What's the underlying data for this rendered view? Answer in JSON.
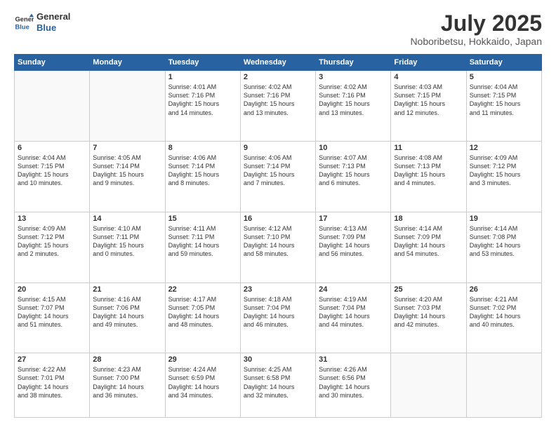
{
  "header": {
    "logo_line1": "General",
    "logo_line2": "Blue",
    "month_title": "July 2025",
    "location": "Noboribetsu, Hokkaido, Japan"
  },
  "days_of_week": [
    "Sunday",
    "Monday",
    "Tuesday",
    "Wednesday",
    "Thursday",
    "Friday",
    "Saturday"
  ],
  "weeks": [
    [
      {
        "day": "",
        "text": ""
      },
      {
        "day": "",
        "text": ""
      },
      {
        "day": "1",
        "text": "Sunrise: 4:01 AM\nSunset: 7:16 PM\nDaylight: 15 hours\nand 14 minutes."
      },
      {
        "day": "2",
        "text": "Sunrise: 4:02 AM\nSunset: 7:16 PM\nDaylight: 15 hours\nand 13 minutes."
      },
      {
        "day": "3",
        "text": "Sunrise: 4:02 AM\nSunset: 7:16 PM\nDaylight: 15 hours\nand 13 minutes."
      },
      {
        "day": "4",
        "text": "Sunrise: 4:03 AM\nSunset: 7:15 PM\nDaylight: 15 hours\nand 12 minutes."
      },
      {
        "day": "5",
        "text": "Sunrise: 4:04 AM\nSunset: 7:15 PM\nDaylight: 15 hours\nand 11 minutes."
      }
    ],
    [
      {
        "day": "6",
        "text": "Sunrise: 4:04 AM\nSunset: 7:15 PM\nDaylight: 15 hours\nand 10 minutes."
      },
      {
        "day": "7",
        "text": "Sunrise: 4:05 AM\nSunset: 7:14 PM\nDaylight: 15 hours\nand 9 minutes."
      },
      {
        "day": "8",
        "text": "Sunrise: 4:06 AM\nSunset: 7:14 PM\nDaylight: 15 hours\nand 8 minutes."
      },
      {
        "day": "9",
        "text": "Sunrise: 4:06 AM\nSunset: 7:14 PM\nDaylight: 15 hours\nand 7 minutes."
      },
      {
        "day": "10",
        "text": "Sunrise: 4:07 AM\nSunset: 7:13 PM\nDaylight: 15 hours\nand 6 minutes."
      },
      {
        "day": "11",
        "text": "Sunrise: 4:08 AM\nSunset: 7:13 PM\nDaylight: 15 hours\nand 4 minutes."
      },
      {
        "day": "12",
        "text": "Sunrise: 4:09 AM\nSunset: 7:12 PM\nDaylight: 15 hours\nand 3 minutes."
      }
    ],
    [
      {
        "day": "13",
        "text": "Sunrise: 4:09 AM\nSunset: 7:12 PM\nDaylight: 15 hours\nand 2 minutes."
      },
      {
        "day": "14",
        "text": "Sunrise: 4:10 AM\nSunset: 7:11 PM\nDaylight: 15 hours\nand 0 minutes."
      },
      {
        "day": "15",
        "text": "Sunrise: 4:11 AM\nSunset: 7:11 PM\nDaylight: 14 hours\nand 59 minutes."
      },
      {
        "day": "16",
        "text": "Sunrise: 4:12 AM\nSunset: 7:10 PM\nDaylight: 14 hours\nand 58 minutes."
      },
      {
        "day": "17",
        "text": "Sunrise: 4:13 AM\nSunset: 7:09 PM\nDaylight: 14 hours\nand 56 minutes."
      },
      {
        "day": "18",
        "text": "Sunrise: 4:14 AM\nSunset: 7:09 PM\nDaylight: 14 hours\nand 54 minutes."
      },
      {
        "day": "19",
        "text": "Sunrise: 4:14 AM\nSunset: 7:08 PM\nDaylight: 14 hours\nand 53 minutes."
      }
    ],
    [
      {
        "day": "20",
        "text": "Sunrise: 4:15 AM\nSunset: 7:07 PM\nDaylight: 14 hours\nand 51 minutes."
      },
      {
        "day": "21",
        "text": "Sunrise: 4:16 AM\nSunset: 7:06 PM\nDaylight: 14 hours\nand 49 minutes."
      },
      {
        "day": "22",
        "text": "Sunrise: 4:17 AM\nSunset: 7:05 PM\nDaylight: 14 hours\nand 48 minutes."
      },
      {
        "day": "23",
        "text": "Sunrise: 4:18 AM\nSunset: 7:04 PM\nDaylight: 14 hours\nand 46 minutes."
      },
      {
        "day": "24",
        "text": "Sunrise: 4:19 AM\nSunset: 7:04 PM\nDaylight: 14 hours\nand 44 minutes."
      },
      {
        "day": "25",
        "text": "Sunrise: 4:20 AM\nSunset: 7:03 PM\nDaylight: 14 hours\nand 42 minutes."
      },
      {
        "day": "26",
        "text": "Sunrise: 4:21 AM\nSunset: 7:02 PM\nDaylight: 14 hours\nand 40 minutes."
      }
    ],
    [
      {
        "day": "27",
        "text": "Sunrise: 4:22 AM\nSunset: 7:01 PM\nDaylight: 14 hours\nand 38 minutes."
      },
      {
        "day": "28",
        "text": "Sunrise: 4:23 AM\nSunset: 7:00 PM\nDaylight: 14 hours\nand 36 minutes."
      },
      {
        "day": "29",
        "text": "Sunrise: 4:24 AM\nSunset: 6:59 PM\nDaylight: 14 hours\nand 34 minutes."
      },
      {
        "day": "30",
        "text": "Sunrise: 4:25 AM\nSunset: 6:58 PM\nDaylight: 14 hours\nand 32 minutes."
      },
      {
        "day": "31",
        "text": "Sunrise: 4:26 AM\nSunset: 6:56 PM\nDaylight: 14 hours\nand 30 minutes."
      },
      {
        "day": "",
        "text": ""
      },
      {
        "day": "",
        "text": ""
      }
    ]
  ]
}
